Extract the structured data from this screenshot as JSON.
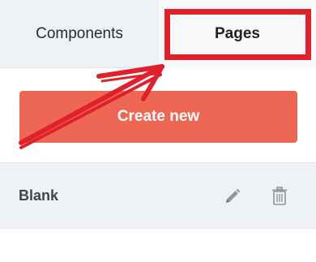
{
  "tabs": {
    "components_label": "Components",
    "pages_label": "Pages",
    "active": "Pages"
  },
  "actions": {
    "create_label": "Create new"
  },
  "pages_list": [
    {
      "name": "Blank"
    }
  ],
  "annotation": {
    "color": "#e0202a"
  },
  "colors": {
    "accent": "#ee6755",
    "tab_bar": "#eef1f5",
    "row_bg": "#eef1f5"
  },
  "icons": {
    "edit": "pencil-icon",
    "delete": "trash-icon"
  }
}
